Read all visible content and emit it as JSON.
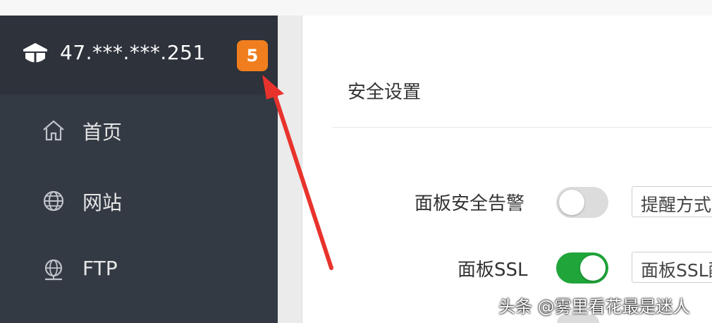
{
  "sidebar": {
    "server_ip": "47.***.***.251",
    "notification_count": "5",
    "items": [
      {
        "label": "首页",
        "icon": "home-icon"
      },
      {
        "label": "网站",
        "icon": "globe-icon"
      },
      {
        "label": "FTP",
        "icon": "ftp-icon"
      }
    ]
  },
  "main": {
    "section_title": "安全设置",
    "rows": [
      {
        "label": "面板安全告警",
        "toggle": "off",
        "select_value": "提醒方式"
      },
      {
        "label": "面板SSL",
        "toggle": "on",
        "select_value": "面板SSL配置"
      }
    ]
  },
  "watermark": "头条 @雾里看花最是迷人",
  "colors": {
    "sidebar": "#343a44",
    "badge": "#f07e1e",
    "toggle_on": "#20a53a",
    "arrow": "#e8332d"
  }
}
